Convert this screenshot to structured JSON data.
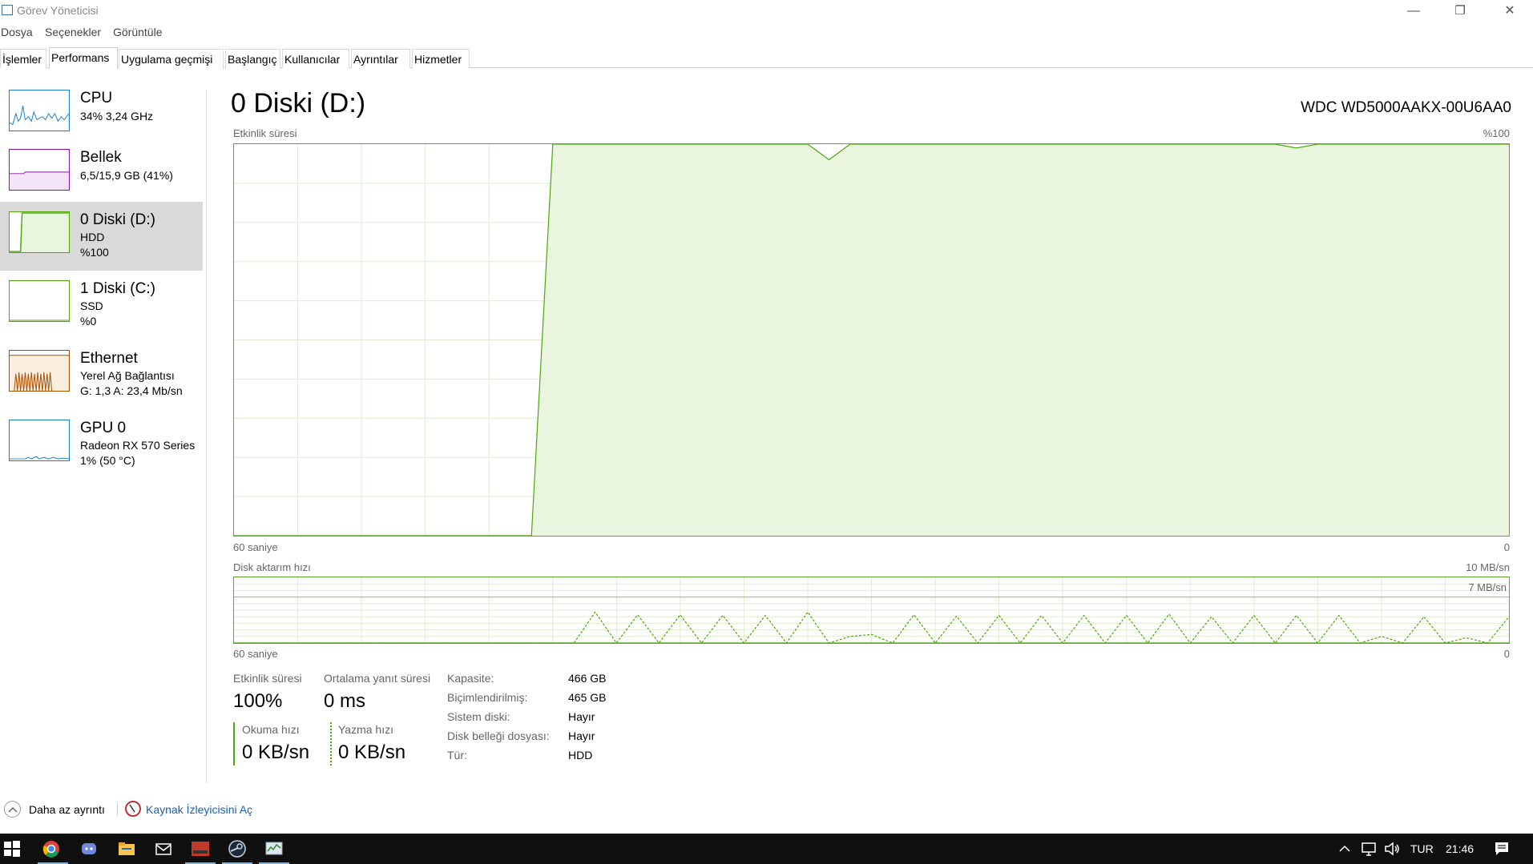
{
  "window": {
    "title": "Görev Yöneticisi",
    "minimize": "—",
    "restore": "❐",
    "close": "✕"
  },
  "menu": [
    "Dosya",
    "Seçenekler",
    "Görüntüle"
  ],
  "tabs": [
    "İşlemler",
    "Performans",
    "Uygulama geçmişi",
    "Başlangıç",
    "Kullanıcılar",
    "Ayrıntılar",
    "Hizmetler"
  ],
  "active_tab": "Performans",
  "sidebar": {
    "items": [
      {
        "title": "CPU",
        "line1": "34%  3,24 GHz",
        "line2": "",
        "color": "#1a7bc4"
      },
      {
        "title": "Bellek",
        "line1": "6,5/15,9 GB (41%)",
        "line2": "",
        "color": "#8b12ae"
      },
      {
        "title": "0 Diski (D:)",
        "line1": "HDD",
        "line2": "%100",
        "color": "#4da60c"
      },
      {
        "title": "1 Diski (C:)",
        "line1": "SSD",
        "line2": "%0",
        "color": "#4da60c"
      },
      {
        "title": "Ethernet",
        "line1": "Yerel Ağ Bağlantısı",
        "line2": "G: 1,3  A: 23,4 Mb/sn",
        "color": "#a74f01"
      },
      {
        "title": "GPU 0",
        "line1": "Radeon RX 570 Series",
        "line2": "1%  (50 °C)",
        "color": "#1a7bc4"
      }
    ]
  },
  "main": {
    "title": "0 Diski (D:)",
    "model": "WDC WD5000AAKX-00U6AA0",
    "activity_chart": {
      "label": "Etkinlik süresi",
      "max_label": "%100",
      "x_left": "60 saniye",
      "x_right": "0"
    },
    "transfer_chart": {
      "label": "Disk aktarım hızı",
      "max_label": "10 MB/sn",
      "ref_label": "7 MB/sn",
      "x_left": "60 saniye",
      "x_right": "0"
    },
    "stats": {
      "activity_label": "Etkinlik süresi",
      "activity_value": "100%",
      "response_label": "Ortalama yanıt süresi",
      "response_value": "0 ms",
      "read_label": "Okuma hızı",
      "read_value": "0 KB/sn",
      "write_label": "Yazma hızı",
      "write_value": "0 KB/sn"
    },
    "properties": [
      {
        "label": "Kapasite:",
        "value": "466 GB"
      },
      {
        "label": "Biçimlendirilmiş:",
        "value": "465 GB"
      },
      {
        "label": "Sistem diski:",
        "value": "Hayır"
      },
      {
        "label": "Disk belleği dosyası:",
        "value": "Hayır"
      },
      {
        "label": "Tür:",
        "value": "HDD"
      }
    ]
  },
  "footer": {
    "less_details": "Daha az ayrıntı",
    "resource_monitor": "Kaynak İzleyicisini Aç"
  },
  "taskbar": {
    "lang": "TUR",
    "time": "21:46"
  },
  "chart_data": [
    {
      "type": "area",
      "title": "Etkinlik süresi",
      "xlabel": "60 saniye",
      "ylabel": "%100",
      "x": [
        60,
        59,
        58,
        57,
        56,
        55,
        54,
        53,
        52,
        51,
        50,
        49,
        48,
        47,
        46,
        45,
        44,
        43,
        42,
        41,
        40,
        39,
        38,
        37,
        36,
        35,
        34,
        33,
        32,
        31,
        30,
        29,
        28,
        27,
        26,
        25,
        24,
        23,
        22,
        21,
        20,
        19,
        18,
        17,
        16,
        15,
        14,
        13,
        12,
        11,
        10,
        9,
        8,
        7,
        6,
        5,
        4,
        3,
        2,
        1,
        0
      ],
      "series": [
        {
          "values": [
            0,
            0,
            0,
            0,
            0,
            0,
            0,
            0,
            0,
            0,
            0,
            0,
            0,
            0,
            0,
            100,
            100,
            100,
            100,
            100,
            100,
            100,
            100,
            100,
            100,
            100,
            100,
            100,
            96,
            100,
            100,
            100,
            100,
            100,
            100,
            100,
            100,
            100,
            100,
            100,
            100,
            100,
            100,
            100,
            100,
            100,
            100,
            100,
            100,
            100,
            99,
            100,
            100,
            100,
            100,
            100,
            100,
            100,
            100,
            100,
            100
          ]
        }
      ],
      "ylim": [
        0,
        100
      ],
      "grid": true
    },
    {
      "type": "line",
      "title": "Disk aktarım hızı",
      "xlabel": "60 saniye",
      "x": [
        60,
        59,
        58,
        57,
        56,
        55,
        54,
        53,
        52,
        51,
        50,
        49,
        48,
        47,
        46,
        45,
        44,
        43,
        42,
        41,
        40,
        39,
        38,
        37,
        36,
        35,
        34,
        33,
        32,
        31,
        30,
        29,
        28,
        27,
        26,
        25,
        24,
        23,
        22,
        21,
        20,
        19,
        18,
        17,
        16,
        15,
        14,
        13,
        12,
        11,
        10,
        9,
        8,
        7,
        6,
        5,
        4,
        3,
        2,
        1,
        0
      ],
      "series": [
        {
          "name": "Okuma hızı",
          "values": [
            0,
            0,
            0,
            0,
            0,
            0,
            0,
            0,
            0,
            0,
            0,
            0,
            0,
            0,
            0,
            0,
            0,
            0,
            0,
            0,
            0,
            0,
            0,
            0,
            0,
            0,
            0,
            0,
            0,
            0,
            0,
            0,
            0,
            0,
            0,
            0,
            0,
            0,
            0,
            0,
            0,
            0,
            0,
            0,
            0,
            0,
            0,
            0,
            0,
            0,
            0,
            0,
            0,
            0,
            0,
            0,
            0,
            0,
            0,
            0,
            0
          ]
        },
        {
          "name": "Yazma hızı",
          "values": [
            0,
            0,
            0,
            0,
            0,
            0,
            0,
            0,
            0,
            0,
            0,
            0,
            0,
            0,
            0,
            0,
            0,
            4.7,
            0,
            4.3,
            0,
            4.3,
            0,
            4.2,
            0,
            4.2,
            0,
            4.7,
            0,
            1.0,
            1.3,
            0,
            4.3,
            0,
            4.1,
            0,
            4.2,
            0,
            4.2,
            0,
            4.2,
            0,
            4.2,
            0,
            4.4,
            0,
            4.0,
            0,
            4.2,
            0,
            4.2,
            0,
            4.2,
            0,
            1.0,
            0,
            4.0,
            0,
            0.8,
            0,
            4.0
          ]
        }
      ],
      "ylim": [
        0,
        10
      ],
      "grid": true
    }
  ]
}
